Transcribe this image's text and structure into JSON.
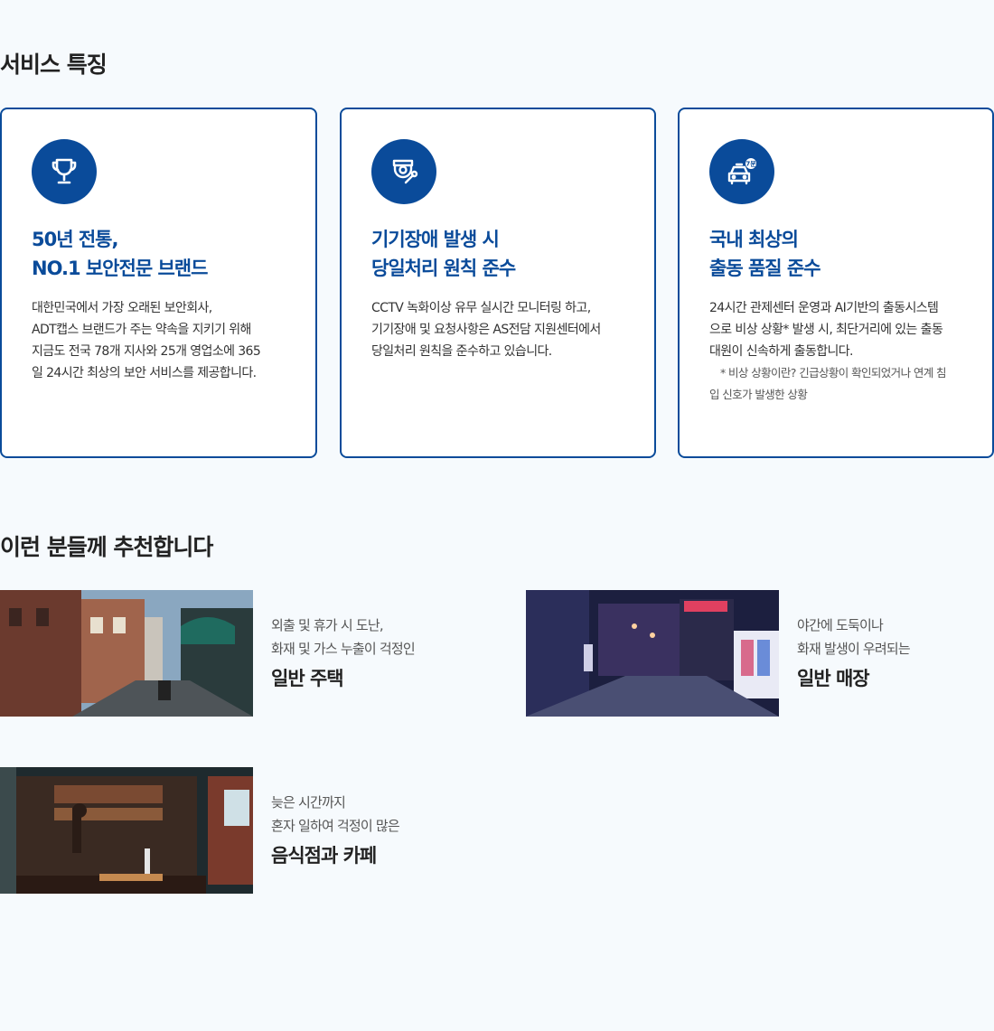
{
  "features": {
    "title": "서비스 특징",
    "cards": [
      {
        "icon": "trophy-icon",
        "head_line1": "50년 전통,",
        "head_line2": "NO.1 보안전문 브랜드",
        "body": [
          "대한민국에서 가장 오래된 보안회사,",
          "ADT캡스 브랜드가 주는 약속을 지키기 위해",
          "지금도 전국 78개 지사와 25개 영업소에 365",
          "일 24시간 최상의 보안 서비스를 제공합니다."
        ]
      },
      {
        "icon": "cctv-wrench-icon",
        "head_line1": "기기장애 발생 시",
        "head_line2": "당일처리 원칙 준수",
        "body": [
          "CCTV 녹화이상 유무 실시간 모니터링 하고,",
          "기기장애 및 요청사항은 AS전담 지원센터에서",
          "당일처리 원칙을 준수하고 있습니다."
        ]
      },
      {
        "icon": "dispatch-car-icon",
        "badge": "7분",
        "head_line1": "국내 최상의",
        "head_line2": "출동 품질 준수",
        "body": [
          "24시간 관제센터 운영과 AI기반의 출동시스템",
          "으로 비상 상황* 발생 시, 최단거리에 있는 출동",
          "대원이 신속하게 출동합니다."
        ],
        "note_line1": "* 비상 상황이란? 긴급상황이 확인되었거나 연계 침",
        "note_line2": "입 신호가 발생한 상황"
      }
    ]
  },
  "recommend": {
    "title": "이런 분들께 추천합니다",
    "items": [
      {
        "sub_line1": "외출 및 휴가 시 도난,",
        "sub_line2": "화재 및 가스 누출이 걱정인",
        "main": "일반 주택"
      },
      {
        "sub_line1": "야간에 도둑이나",
        "sub_line2": "화재 발생이 우려되는",
        "main": "일반 매장"
      },
      {
        "sub_line1": "늦은 시간까지",
        "sub_line2": "혼자 일하여 걱정이 많은",
        "main": "음식점과 카페"
      }
    ]
  },
  "colors": {
    "brand": "#0a4b9a",
    "background": "#f6fafd"
  }
}
